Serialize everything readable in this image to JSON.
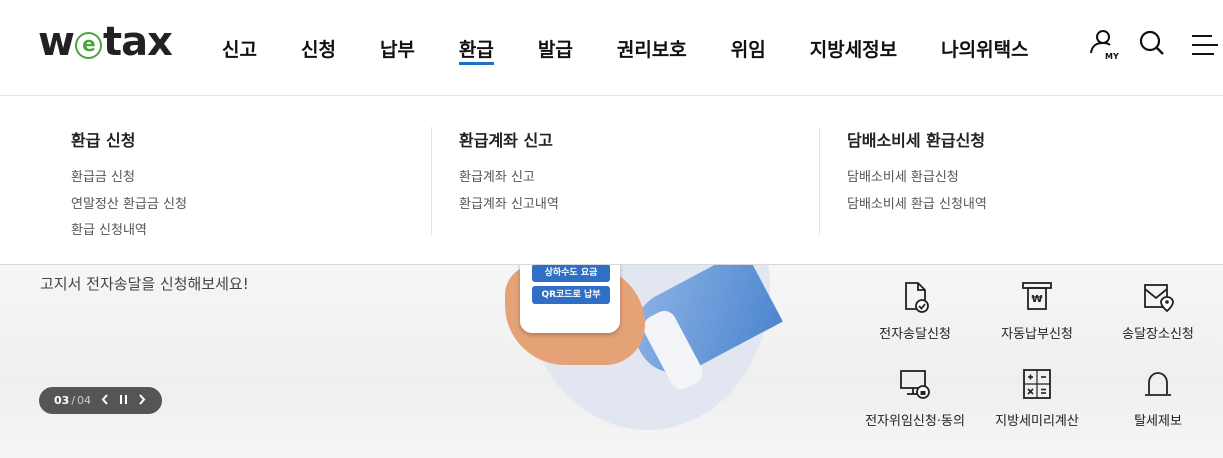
{
  "brand": {
    "logo_left": "w",
    "logo_e": "e",
    "logo_right": "tax"
  },
  "gnb": [
    {
      "label": "신고"
    },
    {
      "label": "신청"
    },
    {
      "label": "납부"
    },
    {
      "label": "환급"
    },
    {
      "label": "발급"
    },
    {
      "label": "권리보호"
    },
    {
      "label": "위임"
    },
    {
      "label": "지방세정보"
    },
    {
      "label": "나의위택스"
    }
  ],
  "utility": {
    "my_label": "MY"
  },
  "mega": {
    "columns": [
      {
        "title": "환급 신청",
        "items": [
          "환급금 신청",
          "연말정산 환급금 신청",
          "환급 신청내역"
        ]
      },
      {
        "title": "환급계좌 신고",
        "items": [
          "환급계좌 신고",
          "환급계좌 신고내역"
        ]
      },
      {
        "title": "담배소비세 환급신청",
        "items": [
          "담배소비세 환급신청",
          "담배소비세 환급 신청내역"
        ]
      }
    ]
  },
  "hero": {
    "text": "고지서 전자송달을 신청해보세요!",
    "phone_buttons": [
      "상하수도 요금",
      "QR코드로 납부"
    ],
    "pager": {
      "current": "03",
      "separator": "/",
      "total": "04"
    }
  },
  "quick_links": [
    {
      "label": "전자송달신청",
      "icon": "document-check-icon"
    },
    {
      "label": "자동납부신청",
      "icon": "auto-pay-icon"
    },
    {
      "label": "송달장소신청",
      "icon": "mail-location-icon"
    },
    {
      "label": "전자위임신청·동의",
      "icon": "monitor-lock-icon"
    },
    {
      "label": "지방세미리계산",
      "icon": "calculator-icon"
    },
    {
      "label": "탈세제보",
      "icon": "siren-icon"
    }
  ],
  "colors": {
    "accent": "#1e6fc8",
    "logo_green": "#4aa63c",
    "pager_bg": "#555555"
  }
}
